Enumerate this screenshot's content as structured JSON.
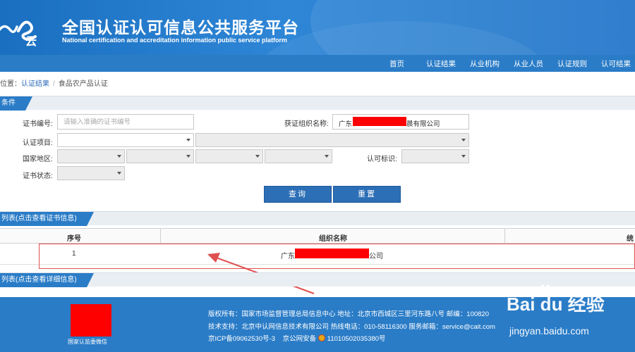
{
  "header": {
    "title": "全国认证认可信息公共服务平台",
    "subtitle": "National certification and accreditation information public service platform",
    "logo_text": "认e云"
  },
  "nav": [
    "首页",
    "认证结果",
    "从业机构",
    "从业人员",
    "认证规则",
    "认可结果"
  ],
  "breadcrumb": {
    "prefix": "位置：",
    "link": "认证结果",
    "sep": "/",
    "current": "食品农产品认证"
  },
  "sections": {
    "conditions": "条件",
    "list": "列表(点击查看证书信息)",
    "detail": "列表(点击查看详细信息)"
  },
  "form": {
    "cert_no_label": "证书编号:",
    "cert_no_placeholder": "请输入准确的证书编号",
    "org_label": "获证组织名称:",
    "org_value_prefix": "广东",
    "org_value_suffix": "晨有限公司",
    "project_label": "认证项目:",
    "region_label": "国家地区:",
    "accr_mark_label": "认可标识:",
    "status_label": "证书状态:",
    "query_button": "查询",
    "reset_button": "重置"
  },
  "table": {
    "headers": [
      "序号",
      "组织名称",
      "统"
    ],
    "rows": [
      {
        "index": "1",
        "org_prefix": "广东",
        "org_suffix": "公司"
      }
    ]
  },
  "footer": {
    "qr_caption": "国家认监委微信",
    "line1": "版权所有：国家市场监督管理总局信息中心   地址：北京市西城区三里河东路八号   邮编：100820",
    "line2": "技术支持：北京中认网信息技术有限公司   热线电话：010-58116300   服务邮箱：service@cait.com",
    "line3_a": "京ICP备09062530号-3",
    "line3_b": "京公网安备",
    "line3_c": "11010502035380号"
  },
  "watermark": {
    "text": "Bai du 经验",
    "url": "jingyan.baidu.com"
  },
  "colors": {
    "primary": "#2a7cc7",
    "header": "#1a6fc0",
    "redaction": "#ff0000",
    "highlight": "#e05050"
  }
}
